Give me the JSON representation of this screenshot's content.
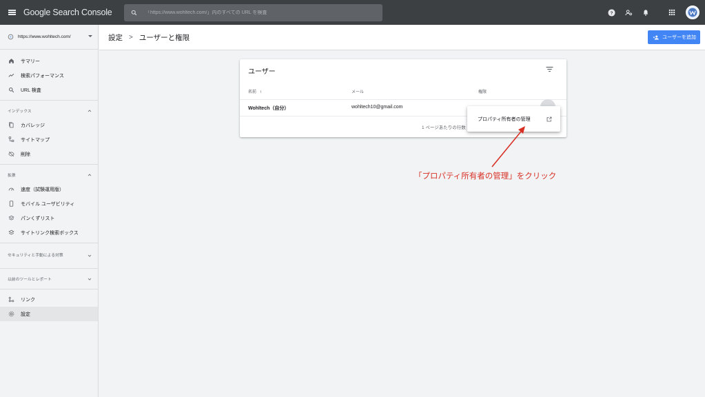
{
  "app": {
    "title": "Google Search Console"
  },
  "search": {
    "placeholder": "「https://www.wohltech.com/」内のすべての URL を検査"
  },
  "sidebar": {
    "property": "https://www.wohltech.com/",
    "items_top": [
      {
        "label": "サマリー",
        "icon": "home-icon"
      },
      {
        "label": "検索パフォーマンス",
        "icon": "trending-icon"
      },
      {
        "label": "URL 検査",
        "icon": "search-icon"
      }
    ],
    "index_section": {
      "title": "インデックス",
      "items": [
        {
          "label": "カバレッジ",
          "icon": "copy-icon"
        },
        {
          "label": "サイトマップ",
          "icon": "sitemap-icon"
        },
        {
          "label": "削除",
          "icon": "eye-off-icon"
        }
      ]
    },
    "ext_section": {
      "title": "拡張",
      "items": [
        {
          "label": "速度（試験運用版）",
          "icon": "speed-icon"
        },
        {
          "label": "モバイル ユーザビリティ",
          "icon": "phone-icon"
        },
        {
          "label": "パンくずリスト",
          "icon": "layers-icon"
        },
        {
          "label": "サイトリンク検索ボックス",
          "icon": "layers-icon"
        }
      ]
    },
    "security_section": {
      "title": "セキュリティと手動による対策"
    },
    "legacy_section": {
      "title": "以前のツールとレポート"
    },
    "items_bottom": [
      {
        "label": "リンク",
        "icon": "link-icon"
      },
      {
        "label": "設定",
        "icon": "gear-icon"
      }
    ]
  },
  "header": {
    "breadcrumb_root": "設定",
    "breadcrumb_sep": ">",
    "breadcrumb_current": "ユーザーと権限",
    "add_user_label": "ユーザーを追加"
  },
  "card": {
    "title": "ユーザー",
    "columns": {
      "name": "名前",
      "email": "メール",
      "permission": "権限"
    },
    "rows": [
      {
        "name": "Wohltech（自分）",
        "email": "wohltech10@gmail.com"
      }
    ],
    "footer": "1 ページあたりの行数"
  },
  "context_menu": {
    "label": "プロパティ所有者の管理"
  },
  "annotation": {
    "text": "「プロパティ所有者の管理」をクリック"
  },
  "colors": {
    "appbar": "#3c4043",
    "accent": "#4285f4",
    "annotation": "#d93025"
  }
}
